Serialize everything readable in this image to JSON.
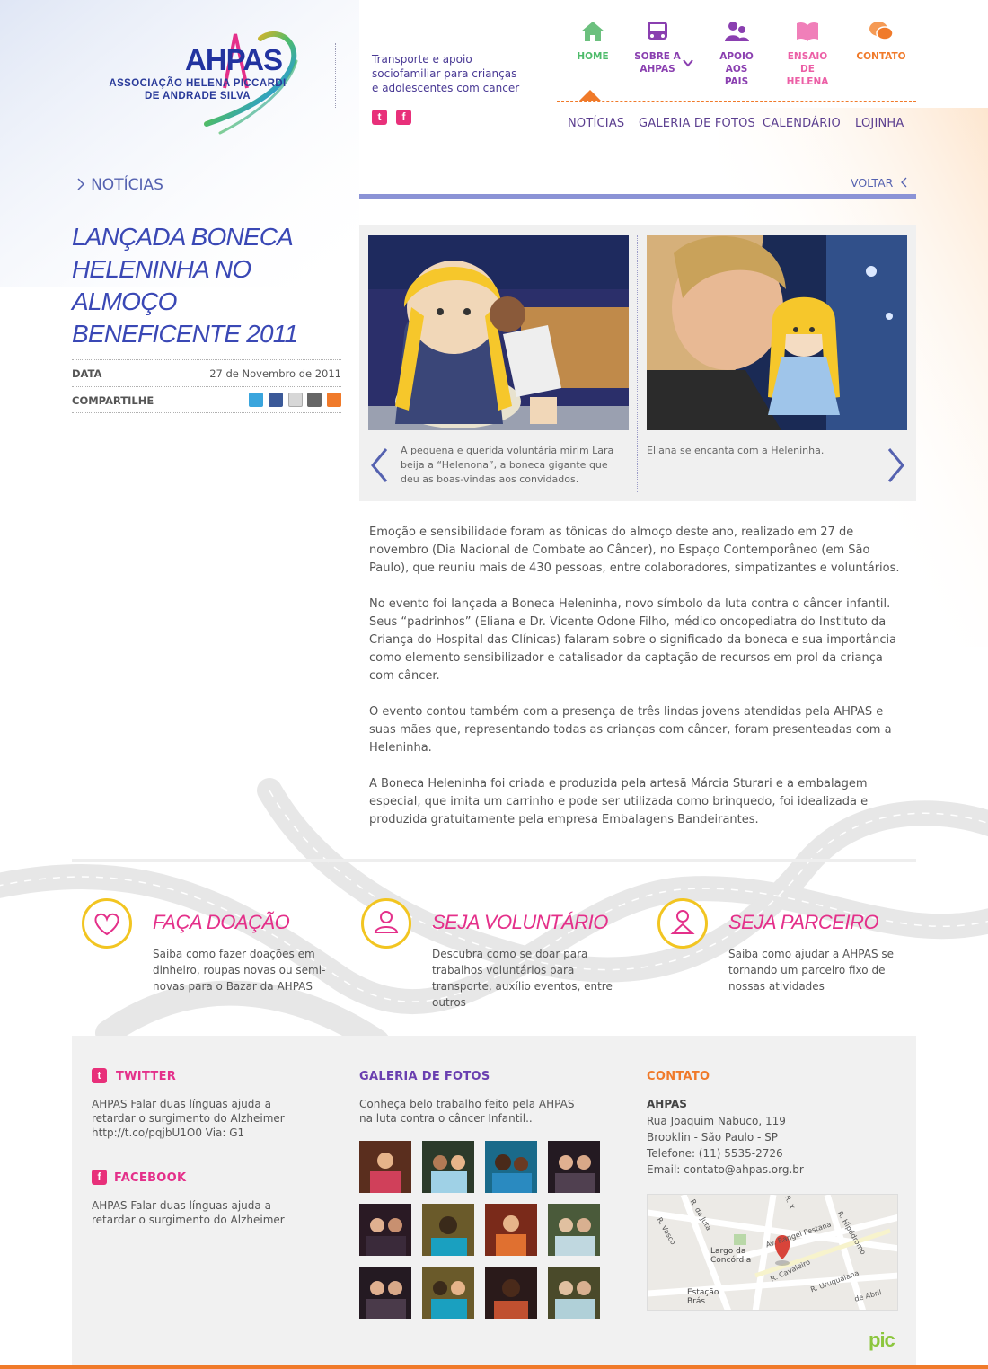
{
  "brand": {
    "logo_text": "AHPAS",
    "logo_subtitle_1": "ASSOCIAÇÃO HELENA PICCARDI",
    "logo_subtitle_2": "DE ANDRADE SILVA",
    "tagline": "Transporte e apoio sociofamiliar para crianças e adolescentes com cancer"
  },
  "social_icons": [
    "twitter-icon",
    "facebook-icon"
  ],
  "nav": {
    "items": [
      {
        "label": "HOME",
        "icon": "home-icon",
        "color": "#4dbb6a"
      },
      {
        "label": "SOBRE A AHPAS",
        "icon": "bus-icon",
        "color": "#8a3fb0"
      },
      {
        "label": "APOIO AOS PAIS",
        "icon": "people-icon",
        "color": "#8a3fb0"
      },
      {
        "label": "ENSAIO DE HELENA",
        "icon": "book-icon",
        "color": "#ec5fa6"
      },
      {
        "label": "CONTATO",
        "icon": "chat-icon",
        "color": "#f07a2a"
      }
    ],
    "sub": [
      "NOTÍCIAS",
      "GALERIA DE FOTOS",
      "CALENDÁRIO",
      "LOJINHA"
    ]
  },
  "breadcrumb": "NOTÍCIAS",
  "back_label": "VOLTAR",
  "article": {
    "title": "LANÇADA BONECA HELENINHA NO ALMOÇO BENEFICENTE 2011",
    "date_label": "DATA",
    "date": "27 de Novembro de 2011",
    "share_label": "COMPARTILHE",
    "share_icons": [
      "twitter-icon",
      "facebook-icon",
      "email-icon",
      "print-icon",
      "plus-icon"
    ],
    "captions": [
      "A pequena e querida voluntária mirim Lara beija a “Helenona”, a boneca gigante que deu as boas-vindas aos convidados.",
      "Eliana se encanta com a Heleninha."
    ],
    "paragraphs": [
      "Emoção e sensibilidade foram as tônicas do almoço deste ano, realizado em 27 de novembro (Dia Nacional de Combate ao Câncer), no Espaço Contemporâneo (em São Paulo), que reuniu mais de 430 pessoas, entre colaboradores, simpatizantes e voluntários.",
      "No evento foi lançada a Boneca Heleninha, novo símbolo da luta contra o câncer infantil. Seus “padrinhos” (Eliana e Dr. Vicente Odone Filho, médico oncopediatra do Instituto da Criança do Hospital das Clínicas) falaram sobre o significado da boneca e sua importância como elemento sensibilizador e catalisador da captação de recursos em prol da criança com câncer.",
      "O evento contou também com a presença de três lindas jovens atendidas pela AHPAS e suas mães que, representando todas as crianças com câncer, foram presenteadas com a Heleninha.",
      "A Boneca Heleninha foi criada e produzida pela artesã Márcia Sturari e a embalagem especial, que imita um carrinho e pode ser utilizada como brinquedo, foi idealizada e produzida gratuitamente pela empresa Embalagens Bandeirantes."
    ]
  },
  "cta": [
    {
      "title": "FAÇA DOAÇÃO",
      "text": "Saiba como fazer doações em dinheiro, roupas novas ou semi-novas para o Bazar da AHPAS",
      "icon": "heart-icon"
    },
    {
      "title": "SEJA VOLUNTÁRIO",
      "text": "Descubra como se doar para trabalhos voluntários para transporte, auxílio eventos, entre outros",
      "icon": "volunteer-icon"
    },
    {
      "title": "SEJA PARCEIRO",
      "text": "Saiba como ajudar a AHPAS se tornando um parceiro fixo de nossas atividades",
      "icon": "partner-icon"
    }
  ],
  "footer": {
    "twitter_title": "TWITTER",
    "twitter_text": "AHPAS Falar duas línguas ajuda a retardar o surgimento do Alzheimer http://t.co/pqjbU1O0 Via: G1",
    "facebook_title": "FACEBOOK",
    "facebook_text": "AHPAS Falar duas línguas ajuda a retardar o surgimento do Alzheimer",
    "gallery_title": "GALERIA DE FOTOS",
    "gallery_text": "Conheça belo trabalho feito pela AHPAS na luta contra o câncer Infantil..",
    "contact_title": "CONTATO",
    "contact_name": "AHPAS",
    "contact_lines": [
      "Rua Joaquim Nabuco, 119",
      "Brooklin - São Paulo - SP",
      "Telefone: (11) 5535-2726",
      "Email: contato@ahpas.org.br"
    ],
    "map_labels": [
      "R. Vasco",
      "R. da Juta",
      "Largo da Concórdia",
      "Av. Rangel Pestana",
      "R. Hipódromo",
      "R. Cavaleiro",
      "R. Uruguaiana",
      "Estação Brás",
      "de Abril",
      "R. X"
    ],
    "signature": "pic"
  },
  "colors": {
    "accent_blue": "#3a48b5",
    "accent_pink": "#e4308a",
    "accent_orange": "#f07a2a",
    "accent_green": "#4dbb6a",
    "yellow": "#f2c521"
  }
}
